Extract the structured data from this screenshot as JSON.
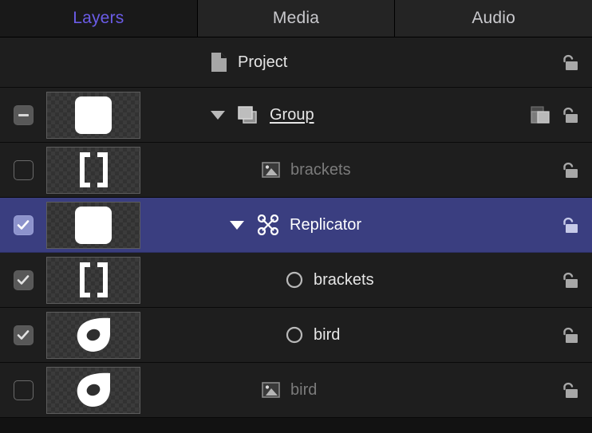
{
  "tabs": [
    {
      "label": "Layers",
      "selected": true
    },
    {
      "label": "Media",
      "selected": false
    },
    {
      "label": "Audio",
      "selected": false
    }
  ],
  "colors": {
    "selection": "#3a3e80",
    "tab_active_text": "#6b5ce7",
    "row_background": "#1e1e1e",
    "text": "#e6e6e6",
    "text_dimmed": "#7b7b7b"
  },
  "rows": [
    {
      "name": "Project",
      "type": "project",
      "kind_icon": "document-icon",
      "checkbox": "none",
      "thumbnail": "none",
      "twisty": "none",
      "selected": false,
      "dimmed": false,
      "underline": false,
      "indent": 0,
      "lock_icon": "unlock-icon",
      "mask_icon": null
    },
    {
      "name": "Group",
      "type": "group",
      "kind_icon": "group-icon",
      "checkbox": "mixed",
      "thumbnail": "rounded-square",
      "twisty": "expanded",
      "selected": false,
      "dimmed": false,
      "underline": true,
      "indent": 0,
      "lock_icon": "unlock-icon",
      "mask_icon": "mask-icon"
    },
    {
      "name": "brackets",
      "type": "image",
      "kind_icon": "image-icon",
      "checkbox": "off",
      "thumbnail": "brackets",
      "twisty": "none",
      "selected": false,
      "dimmed": true,
      "underline": false,
      "indent": 1,
      "lock_icon": "unlock-icon",
      "mask_icon": null
    },
    {
      "name": "Replicator",
      "type": "replicator",
      "kind_icon": "replicator-icon",
      "checkbox": "on",
      "thumbnail": "rounded-square",
      "twisty": "expanded",
      "selected": true,
      "dimmed": false,
      "underline": false,
      "indent": 1,
      "lock_icon": "unlock-icon",
      "mask_icon": null
    },
    {
      "name": "brackets",
      "type": "shape",
      "kind_icon": "circle-shape-icon",
      "checkbox": "on",
      "thumbnail": "brackets",
      "twisty": "none",
      "selected": false,
      "dimmed": false,
      "underline": false,
      "indent": 2,
      "lock_icon": "unlock-icon",
      "mask_icon": null
    },
    {
      "name": "bird",
      "type": "shape",
      "kind_icon": "circle-shape-icon",
      "checkbox": "on",
      "thumbnail": "bird",
      "twisty": "none",
      "selected": false,
      "dimmed": false,
      "underline": false,
      "indent": 2,
      "lock_icon": "unlock-icon",
      "mask_icon": null
    },
    {
      "name": "bird",
      "type": "image",
      "kind_icon": "image-icon",
      "checkbox": "off",
      "thumbnail": "bird",
      "twisty": "none",
      "selected": false,
      "dimmed": true,
      "underline": false,
      "indent": 1,
      "lock_icon": "unlock-icon",
      "mask_icon": null
    }
  ]
}
